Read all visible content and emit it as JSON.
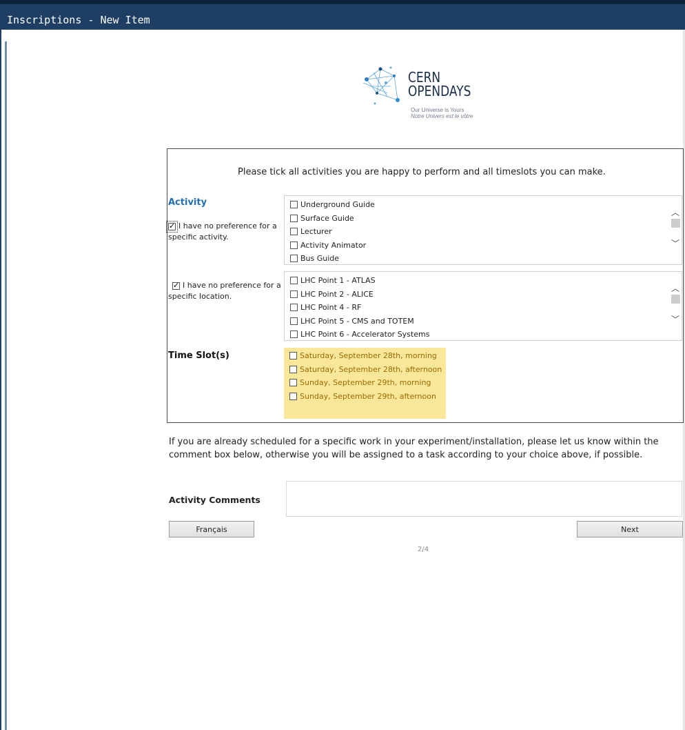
{
  "window": {
    "title": "Inscriptions - New Item"
  },
  "logo": {
    "line1": "CERN",
    "line2": "OPENDAYS",
    "tagline_en": "Our Universe is Yours",
    "tagline_fr": "Notre Univers est le vôtre"
  },
  "form": {
    "instruction": "Please tick all activities you are happy to perform and all timeslots you can make.",
    "activity": {
      "heading": "Activity",
      "heading_color": "#1f6fb2",
      "no_pref_label": "I have no preference for a specific activity.",
      "no_pref_checked": true,
      "options": [
        "Underground Guide",
        "Surface Guide",
        "Lecturer",
        "Activity Animator",
        "Bus Guide"
      ]
    },
    "location": {
      "no_pref_label": "I have no preference for a specific location.",
      "no_pref_checked": true,
      "options": [
        "LHC Point 1 - ATLAS",
        "LHC Point 2 - ALICE",
        "LHC Point 4 - RF",
        "LHC Point 5 - CMS and TOTEM",
        "LHC Point 6 - Accelerator Systems"
      ]
    },
    "time_slots": {
      "heading": "Time Slot(s)",
      "options": [
        "Saturday, September 28th, morning",
        "Saturday, September 28th, afternoon",
        "Sunday, September 29th, morning",
        "Sunday, September 29th, afternoon"
      ]
    }
  },
  "note": "If you are already scheduled for a specific work in your experiment/installation, please let us know within the comment box below, otherwise you will be assigned to a task according to your choice above, if possible.",
  "comments": {
    "label": "Activity Comments",
    "value": ""
  },
  "buttons": {
    "language": "Français",
    "next": "Next"
  },
  "pagination": "2/4",
  "icons": {
    "scroll_up": "chevron-up-icon",
    "scroll_down": "chevron-down-icon"
  }
}
